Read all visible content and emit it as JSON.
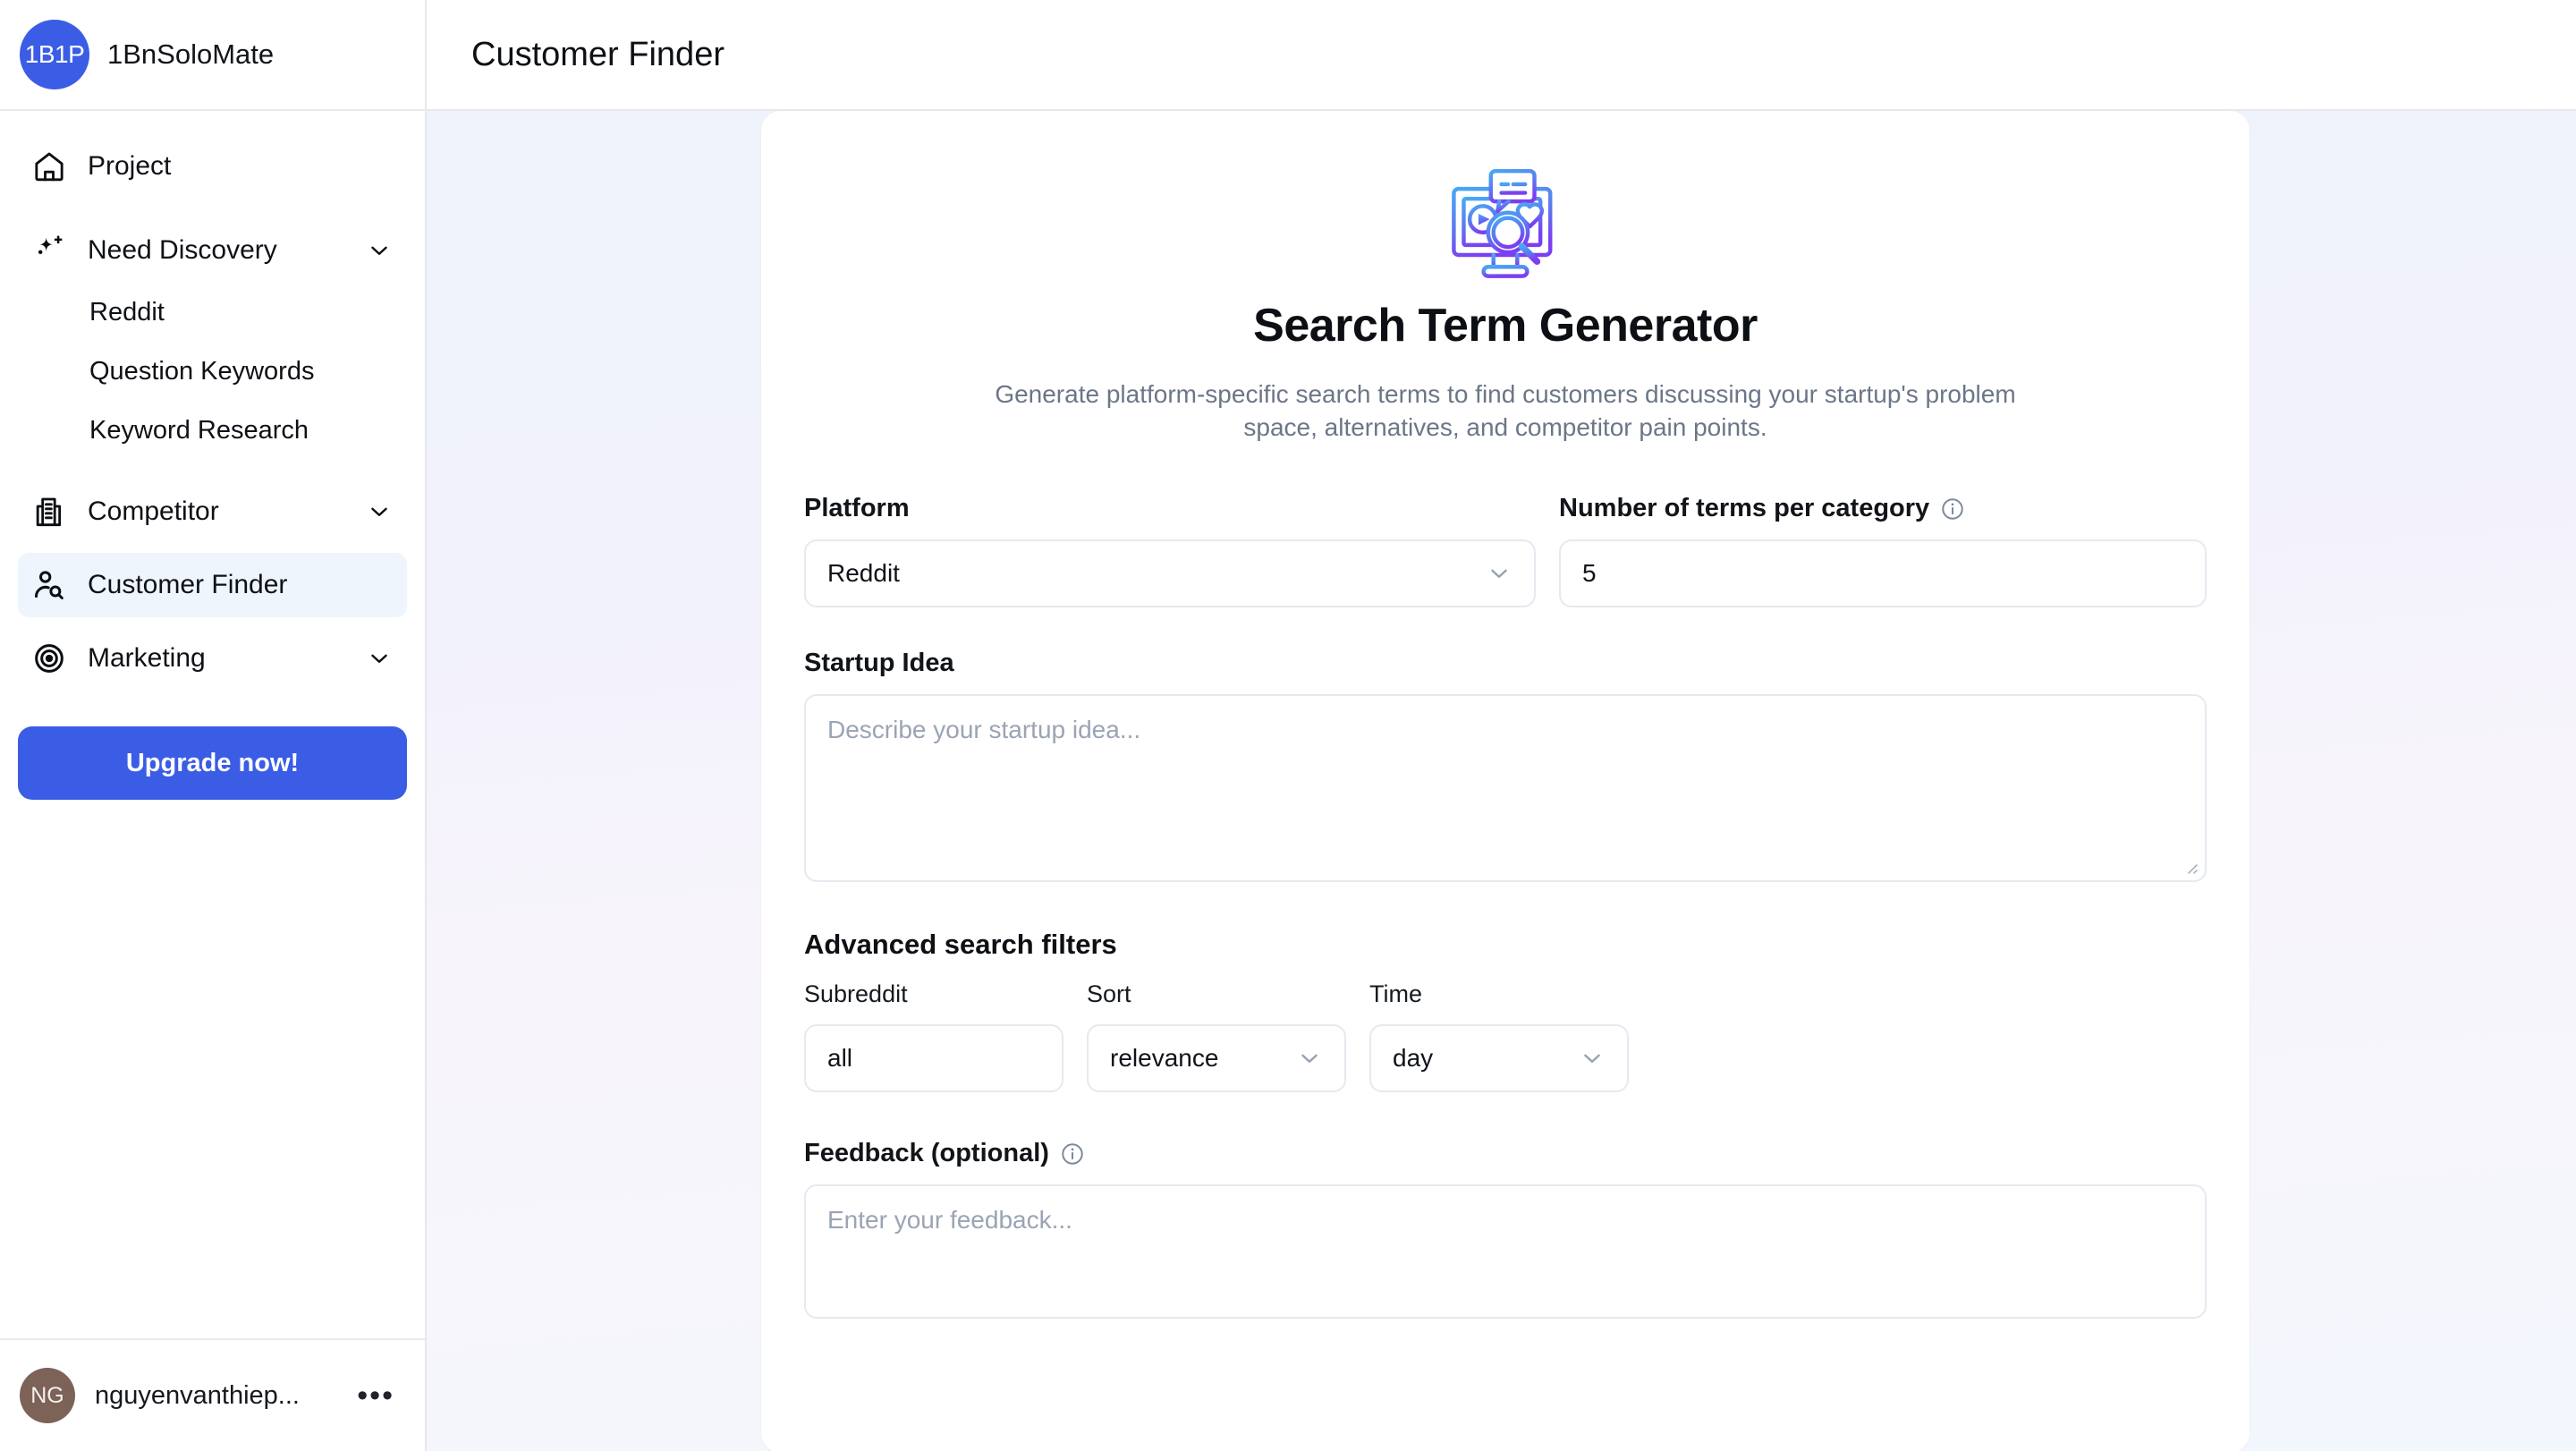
{
  "sidebar": {
    "brand": {
      "initials": "1B1P",
      "name": "1BnSoloMate"
    },
    "items": [
      {
        "label": "Project",
        "icon": "home-icon",
        "type": "item"
      },
      {
        "label": "Need Discovery",
        "icon": "sparkle-icon",
        "type": "group",
        "chevron": "chevron-down-icon"
      },
      {
        "label": "Reddit",
        "type": "sub"
      },
      {
        "label": "Question Keywords",
        "type": "sub"
      },
      {
        "label": "Keyword Research",
        "type": "sub"
      },
      {
        "label": "Competitor",
        "icon": "building-icon",
        "type": "group",
        "chevron": "chevron-down-icon"
      },
      {
        "label": "Customer Finder",
        "icon": "person-search-icon",
        "type": "item",
        "active": true
      },
      {
        "label": "Marketing",
        "icon": "target-icon",
        "type": "group",
        "chevron": "chevron-down-icon"
      }
    ],
    "upgrade_label": "Upgrade now!",
    "user": {
      "initials": "NG",
      "name": "nguyenvanthiep...",
      "menu": "•••"
    }
  },
  "header": {
    "title": "Customer Finder"
  },
  "hero": {
    "icon": "monitor-search-icon",
    "title": "Search Term Generator",
    "subtitle": "Generate platform-specific search terms to find customers discussing your startup's problem space, alternatives, and competitor pain points."
  },
  "form": {
    "platform": {
      "label": "Platform",
      "value": "Reddit"
    },
    "terms_count": {
      "label": "Number of terms per category",
      "value": "5",
      "info": "info-icon"
    },
    "startup_idea": {
      "label": "Startup Idea",
      "placeholder": "Describe your startup idea...",
      "value": ""
    },
    "advanced": {
      "title": "Advanced search filters",
      "subreddit": {
        "label": "Subreddit",
        "value": "all"
      },
      "sort": {
        "label": "Sort",
        "value": "relevance"
      },
      "time": {
        "label": "Time",
        "value": "day"
      }
    },
    "feedback": {
      "label": "Feedback (optional)",
      "placeholder": "Enter your feedback...",
      "value": "",
      "info": "info-icon"
    }
  },
  "colors": {
    "accent": "#3b5ce5",
    "active_nav_bg": "#eff5fd",
    "avatar_user": "#7c6257",
    "muted_text": "#6b7688",
    "border": "#e6e9f0"
  }
}
